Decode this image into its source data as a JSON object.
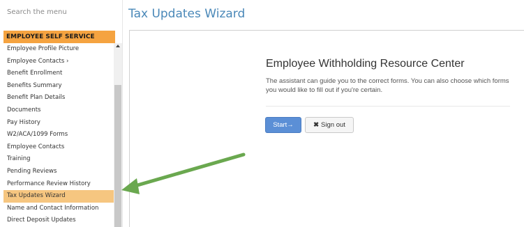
{
  "sidebar": {
    "search_placeholder": "Search the menu",
    "section_header": "EMPLOYEE SELF SERVICE",
    "items": [
      {
        "label": "Employee Profile Picture"
      },
      {
        "label": "Employee Contacts  ›"
      },
      {
        "label": "Benefit Enrollment"
      },
      {
        "label": "Benefits Summary"
      },
      {
        "label": "Benefit Plan Details"
      },
      {
        "label": "Documents"
      },
      {
        "label": "Pay History"
      },
      {
        "label": "W2/ACA/1099 Forms"
      },
      {
        "label": "Employee Contacts"
      },
      {
        "label": "Training"
      },
      {
        "label": "Pending Reviews"
      },
      {
        "label": "Performance Review History"
      },
      {
        "label": "Tax Updates Wizard"
      },
      {
        "label": "Name and Contact Information"
      },
      {
        "label": "Direct Deposit Updates"
      }
    ],
    "active_item": "Tax Updates Wizard"
  },
  "main": {
    "title": "Tax Updates Wizard",
    "content_title": "Employee Withholding Resource Center",
    "content_description": "The assistant can guide you to the correct forms. You can also choose which forms you would like to fill out if you're certain.",
    "start_button": "Start",
    "start_icon": "→",
    "signout_button": "Sign out",
    "signout_icon": "✖"
  },
  "colors": {
    "section_header_bg": "#f5a340",
    "active_item_bg": "#f6c680",
    "title_color": "#4a88b8",
    "start_button_bg": "#5b8fd6",
    "annotation_arrow": "#6aa84f"
  }
}
